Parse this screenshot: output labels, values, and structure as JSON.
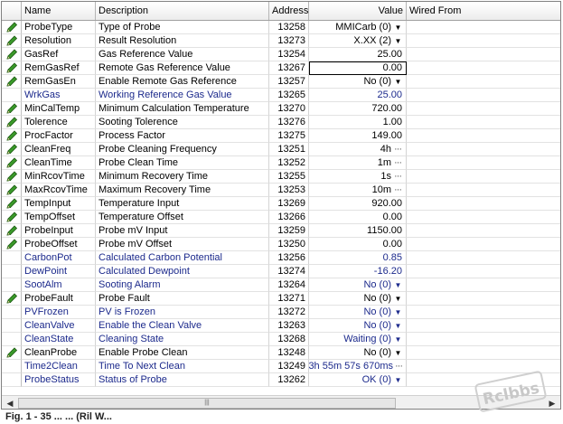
{
  "header": {
    "name": "Name",
    "description": "Description",
    "address": "Address",
    "value": "Value",
    "wired_from": "Wired From"
  },
  "rows": [
    {
      "name": "ProbeType",
      "description": "Type of Probe",
      "address": "13258",
      "value": "MMICarb (0)",
      "control": "dropdown",
      "editable": true
    },
    {
      "name": "Resolution",
      "description": "Result Resolution",
      "address": "13273",
      "value": "X.XX (2)",
      "control": "dropdown",
      "editable": true
    },
    {
      "name": "GasRef",
      "description": "Gas Reference Value",
      "address": "13254",
      "value": "25.00",
      "control": "none",
      "editable": true
    },
    {
      "name": "RemGasRef",
      "description": "Remote Gas Reference Value",
      "address": "13267",
      "value": "0.00",
      "control": "none",
      "editable": true,
      "selected": true
    },
    {
      "name": "RemGasEn",
      "description": "Enable Remote Gas Reference",
      "address": "13257",
      "value": "No (0)",
      "control": "dropdown",
      "editable": true
    },
    {
      "name": "WrkGas",
      "description": "Working Reference Gas Value",
      "address": "13265",
      "value": "25.00",
      "control": "none",
      "editable": false
    },
    {
      "name": "MinCalTemp",
      "description": "Minimum Calculation Temperature",
      "address": "13270",
      "value": "720.00",
      "control": "none",
      "editable": true
    },
    {
      "name": "Tolerence",
      "description": "Sooting Tolerence",
      "address": "13276",
      "value": "1.00",
      "control": "none",
      "editable": true
    },
    {
      "name": "ProcFactor",
      "description": "Process Factor",
      "address": "13275",
      "value": "149.00",
      "control": "none",
      "editable": true
    },
    {
      "name": "CleanFreq",
      "description": "Probe Cleaning Frequency",
      "address": "13251",
      "value": "4h",
      "control": "ellipsis",
      "editable": true
    },
    {
      "name": "CleanTime",
      "description": "Probe Clean Time",
      "address": "13252",
      "value": "1m",
      "control": "ellipsis",
      "editable": true
    },
    {
      "name": "MinRcovTime",
      "description": "Minimum Recovery Time",
      "address": "13255",
      "value": "1s",
      "control": "ellipsis",
      "editable": true
    },
    {
      "name": "MaxRcovTime",
      "description": "Maximum Recovery Time",
      "address": "13253",
      "value": "10m",
      "control": "ellipsis",
      "editable": true
    },
    {
      "name": "TempInput",
      "description": "Temperature Input",
      "address": "13269",
      "value": "920.00",
      "control": "none",
      "editable": true
    },
    {
      "name": "TempOffset",
      "description": "Temperature Offset",
      "address": "13266",
      "value": "0.00",
      "control": "none",
      "editable": true
    },
    {
      "name": "ProbeInput",
      "description": "Probe mV Input",
      "address": "13259",
      "value": "1150.00",
      "control": "none",
      "editable": true
    },
    {
      "name": "ProbeOffset",
      "description": "Probe mV Offset",
      "address": "13250",
      "value": "0.00",
      "control": "none",
      "editable": true
    },
    {
      "name": "CarbonPot",
      "description": "Calculated Carbon Potential",
      "address": "13256",
      "value": "0.85",
      "control": "none",
      "editable": false
    },
    {
      "name": "DewPoint",
      "description": "Calculated Dewpoint",
      "address": "13274",
      "value": "-16.20",
      "control": "none",
      "editable": false
    },
    {
      "name": "SootAlm",
      "description": "Sooting Alarm",
      "address": "13264",
      "value": "No (0)",
      "control": "dropdown",
      "editable": false
    },
    {
      "name": "ProbeFault",
      "description": "Probe Fault",
      "address": "13271",
      "value": "No (0)",
      "control": "dropdown",
      "editable": true
    },
    {
      "name": "PVFrozen",
      "description": "PV is Frozen",
      "address": "13272",
      "value": "No (0)",
      "control": "dropdown",
      "editable": false
    },
    {
      "name": "CleanValve",
      "description": "Enable the Clean Valve",
      "address": "13263",
      "value": "No (0)",
      "control": "dropdown",
      "editable": false
    },
    {
      "name": "CleanState",
      "description": "Cleaning State",
      "address": "13268",
      "value": "Waiting (0)",
      "control": "dropdown",
      "editable": false
    },
    {
      "name": "CleanProbe",
      "description": "Enable Probe Clean",
      "address": "13248",
      "value": "No (0)",
      "control": "dropdown",
      "editable": true
    },
    {
      "name": "Time2Clean",
      "description": "Time To Next Clean",
      "address": "13249",
      "value": "3h 55m 57s 670ms",
      "control": "ellipsis",
      "editable": false
    },
    {
      "name": "ProbeStatus",
      "description": "Status of Probe",
      "address": "13262",
      "value": "OK (0)",
      "control": "dropdown",
      "editable": false
    }
  ],
  "icons": {
    "editable": "pencil-icon",
    "dropdown": "dropdown-arrow-icon",
    "ellipsis": "ellipsis-icon"
  },
  "colors": {
    "readonly_text": "#1c2a8c",
    "pencil": "#2e7d1e"
  },
  "footer_text": "Fig. 1 - 35 ... ... (Ril W..."
}
